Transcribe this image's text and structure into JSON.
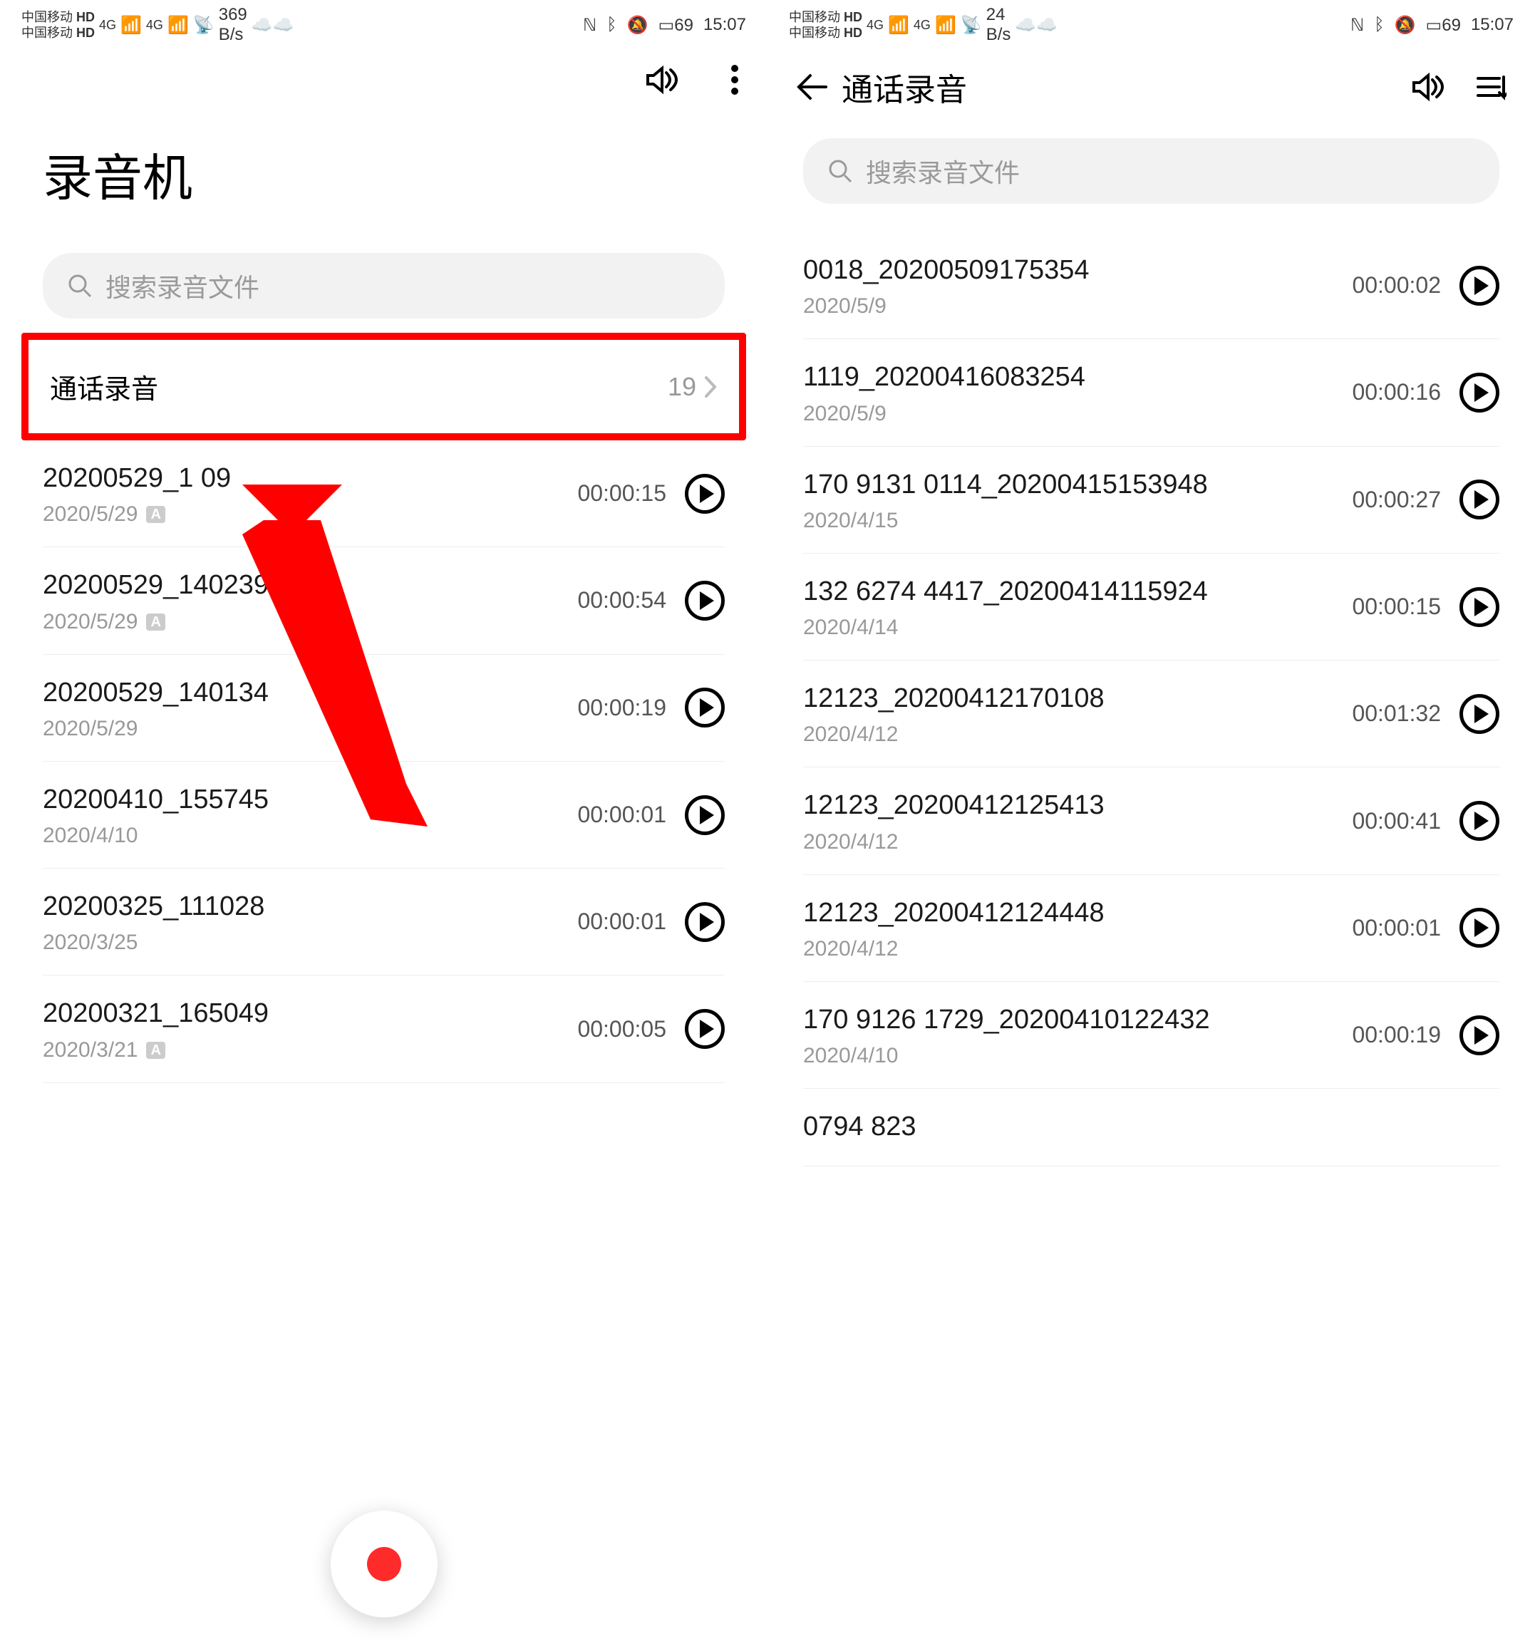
{
  "status": {
    "carrier": "中国移动",
    "net": "4G",
    "speed1": "369",
    "speed2": "24",
    "speed_unit": "B/s",
    "battery": "69",
    "time": "15:07"
  },
  "left": {
    "title": "录音机",
    "search_placeholder": "搜索录音文件",
    "folder_label": "通话录音",
    "folder_count": "19",
    "items": [
      {
        "name": "20200529_1   09",
        "date": "2020/5/29",
        "badge": true,
        "duration": "00:00:15"
      },
      {
        "name": "20200529_140239",
        "date": "2020/5/29",
        "badge": true,
        "duration": "00:00:54"
      },
      {
        "name": "20200529_140134",
        "date": "2020/5/29",
        "badge": false,
        "duration": "00:00:19"
      },
      {
        "name": "20200410_155745",
        "date": "2020/4/10",
        "badge": false,
        "duration": "00:00:01"
      },
      {
        "name": "20200325_111028",
        "date": "2020/3/25",
        "badge": false,
        "duration": "00:00:01"
      },
      {
        "name": "20200321_165049",
        "date": "2020/3/21",
        "badge": true,
        "duration": "00:00:05"
      }
    ]
  },
  "right": {
    "title": "通话录音",
    "search_placeholder": "搜索录音文件",
    "items": [
      {
        "name": "0018_20200509175354",
        "date": "2020/5/9",
        "duration": "00:00:02"
      },
      {
        "name": "1119_20200416083254",
        "date": "2020/5/9",
        "duration": "00:00:16"
      },
      {
        "name": "170 9131 0114_20200415153948",
        "date": "2020/4/15",
        "duration": "00:00:27"
      },
      {
        "name": "132 6274 4417_20200414115924",
        "date": "2020/4/14",
        "duration": "00:00:15"
      },
      {
        "name": "12123_20200412170108",
        "date": "2020/4/12",
        "duration": "00:01:32"
      },
      {
        "name": "12123_20200412125413",
        "date": "2020/4/12",
        "duration": "00:00:41"
      },
      {
        "name": "12123_20200412124448",
        "date": "2020/4/12",
        "duration": "00:00:01"
      },
      {
        "name": "170 9126 1729_20200410122432",
        "date": "2020/4/10",
        "duration": "00:00:19"
      },
      {
        "name": "0794 823",
        "date": "",
        "duration": ""
      }
    ]
  }
}
